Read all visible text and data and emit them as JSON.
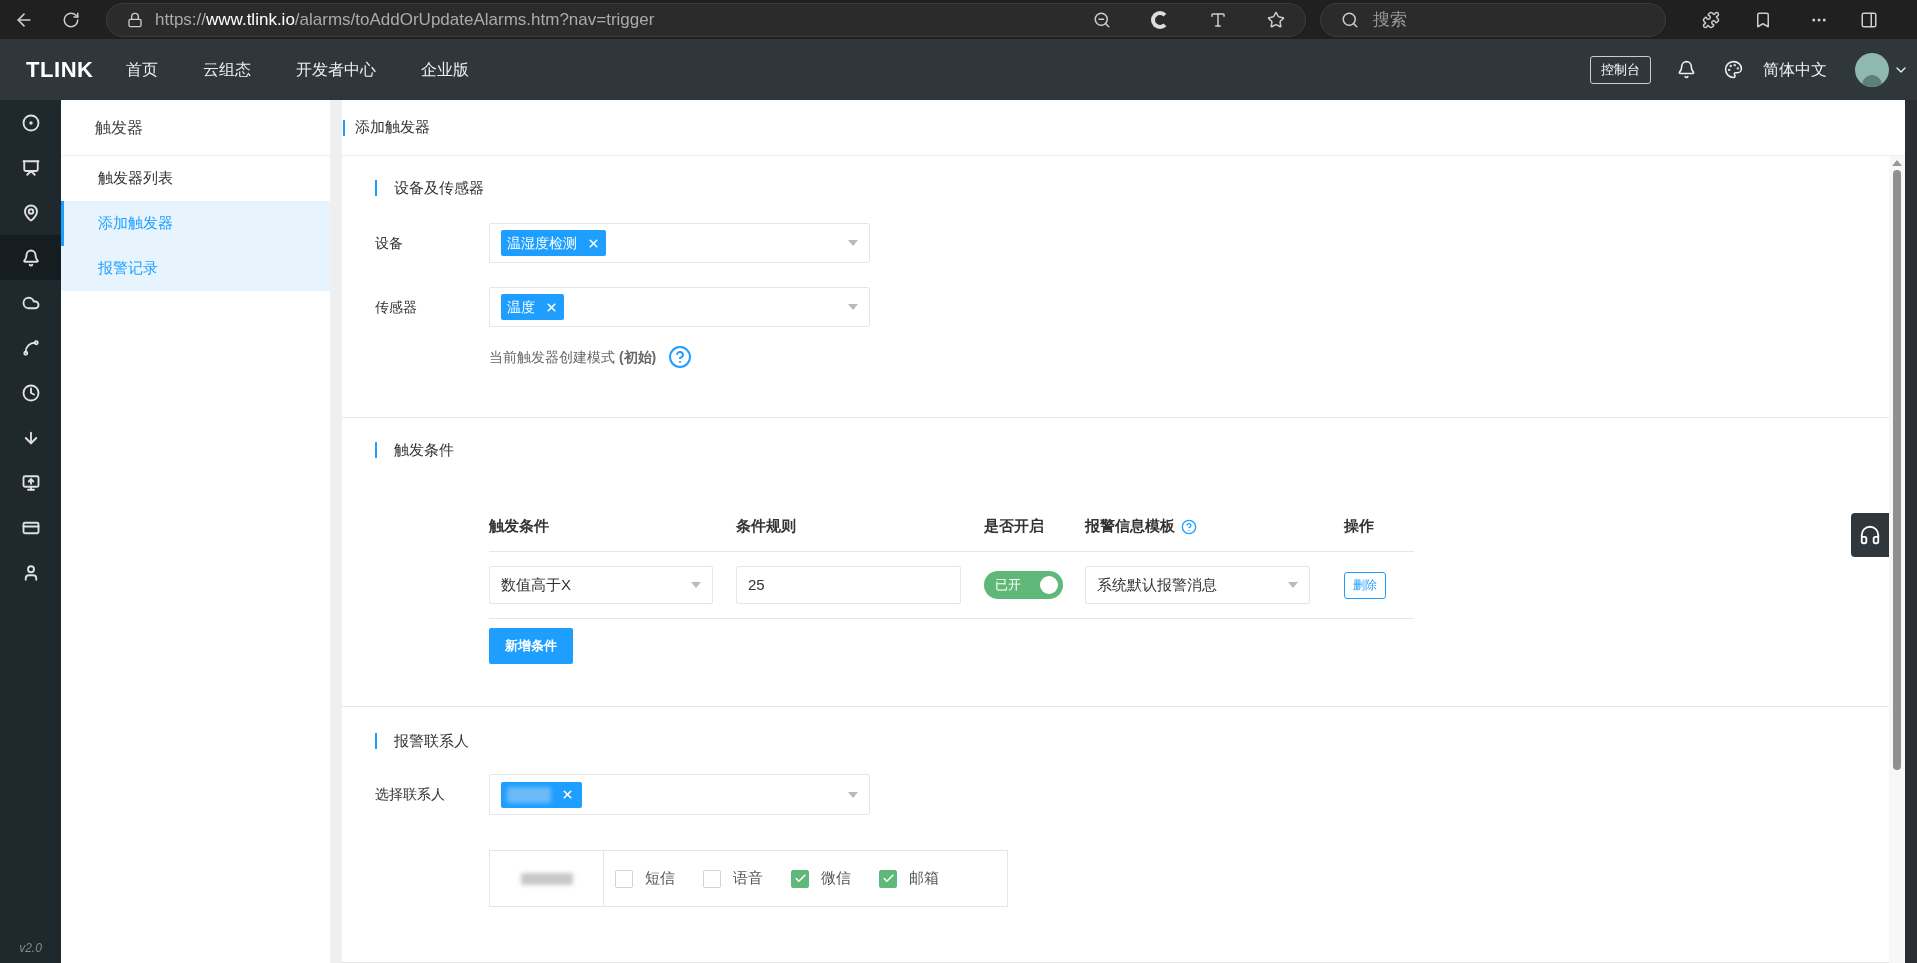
{
  "browser": {
    "url_prefix": "https://",
    "url_host": "www.tlink.io",
    "url_path": "/alarms/toAddOrUpdateAlarms.htm?nav=trigger",
    "search_placeholder": "搜索"
  },
  "header": {
    "logo": "TLINK",
    "nav": [
      "首页",
      "云组态",
      "开发者中心",
      "企业版"
    ],
    "console_button": "控制台",
    "language": "简体中文"
  },
  "sidebar_icons": [
    {
      "selected": false
    },
    {
      "selected": false
    },
    {
      "selected": false
    },
    {
      "selected": true
    },
    {
      "selected": false
    },
    {
      "selected": false
    },
    {
      "selected": false
    },
    {
      "selected": false
    },
    {
      "selected": false
    },
    {
      "selected": false
    },
    {
      "selected": false
    }
  ],
  "version": "v2.0",
  "submenu": {
    "title": "触发器",
    "items": [
      {
        "label": "触发器列表",
        "selected": false,
        "highlighted": false
      },
      {
        "label": "添加触发器",
        "selected": true,
        "highlighted": true
      },
      {
        "label": "报警记录",
        "selected": false,
        "highlighted": true
      }
    ]
  },
  "page_title": "添加触发器",
  "device_section": {
    "title": "设备及传感器",
    "fields": [
      {
        "label": "设备",
        "tags": [
          "温湿度检测"
        ]
      },
      {
        "label": "传感器",
        "tags": [
          "温度"
        ]
      }
    ],
    "mode_note": "当前触发器创建模式 **(初始)**"
  },
  "conditions_section": {
    "title": "触发条件",
    "columns": [
      "触发条件",
      "条件规则",
      "是否开启",
      "报警信息模板",
      "操作"
    ],
    "rows": [
      {
        "condition": "数值高于X",
        "rule": "25",
        "enabled": true,
        "toggle_label": "已开",
        "template": "系统默认报警消息",
        "action": "删除"
      }
    ],
    "add_button": "新增条件"
  },
  "contacts_section": {
    "title": "报警联系人",
    "label": "选择联系人",
    "channels": [
      {
        "label": "短信",
        "checked": false
      },
      {
        "label": "语音",
        "checked": false
      },
      {
        "label": "微信",
        "checked": true
      },
      {
        "label": "邮箱",
        "checked": true
      }
    ]
  }
}
